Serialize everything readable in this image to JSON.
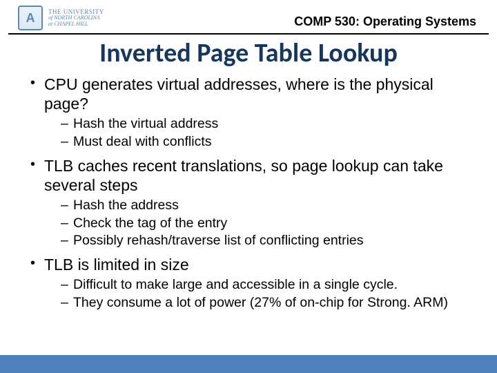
{
  "header": {
    "logo": {
      "seal_letter": "A",
      "line1": "THE UNIVERSITY",
      "line2": "of NORTH CAROLINA",
      "line3": "at CHAPEL HILL"
    },
    "course": "COMP 530: Operating Systems"
  },
  "title": "Inverted Page Table Lookup",
  "bullets": [
    {
      "text": "CPU generates virtual addresses, where is the physical page?",
      "sub": [
        "Hash the virtual address",
        "Must deal with conflicts"
      ]
    },
    {
      "text": "TLB caches recent translations, so page lookup can take several steps",
      "sub": [
        "Hash the address",
        "Check the tag of the entry",
        "Possibly rehash/traverse list of conflicting entries"
      ]
    },
    {
      "text": "TLB is limited in size",
      "sub": [
        "Difficult to make large and accessible in a single cycle.",
        "They consume a lot of power (27% of on-chip for Strong. ARM)"
      ]
    }
  ]
}
